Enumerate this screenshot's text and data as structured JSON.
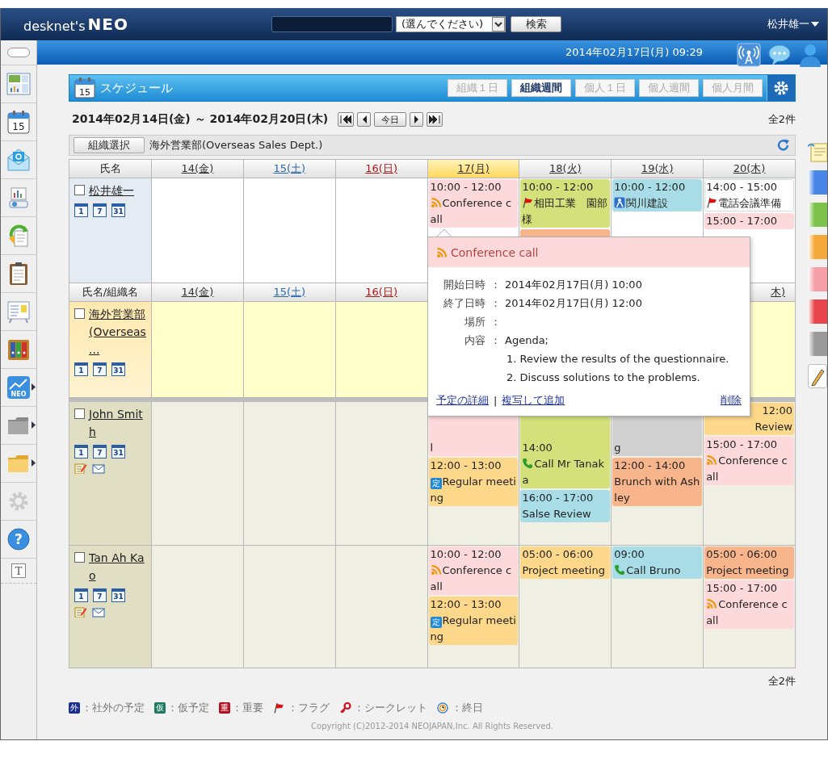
{
  "top_bar": {
    "logo": [
      "desknet's",
      "NEO"
    ],
    "search_select": "(選んでください)",
    "search_button": "検索",
    "user": "松井雄一"
  },
  "band": {
    "datetime": "2014年02月17日(月) 09:29",
    "tools": [
      {
        "kind": "antenna"
      },
      {
        "kind": "chat"
      },
      {
        "kind": "user"
      }
    ]
  },
  "sidebar": {
    "items": [
      {
        "kind": "toggle"
      },
      {
        "kind": "portal"
      },
      {
        "kind": "schedule",
        "label": "15"
      },
      {
        "kind": "mail"
      },
      {
        "kind": "projector"
      },
      {
        "kind": "workflow"
      },
      {
        "kind": "clipboard"
      },
      {
        "kind": "board"
      },
      {
        "kind": "binders"
      },
      {
        "kind": "chart",
        "label": "NEO",
        "submenu": true
      },
      {
        "kind": "folder_grey",
        "submenu": true
      },
      {
        "kind": "folder_yellow",
        "submenu": true
      },
      {
        "kind": "settings",
        "disabled": true
      },
      {
        "kind": "help",
        "label": "?"
      },
      {
        "kind": "text",
        "label": "T"
      }
    ]
  },
  "schedule": {
    "app_day": "15",
    "title": "スケジュール",
    "tabs": [
      {
        "label": "組織１日",
        "selected": false
      },
      {
        "label": "組織週間",
        "selected": true
      },
      {
        "label": "個人１日",
        "selected": false
      },
      {
        "label": "個人週間",
        "selected": false
      },
      {
        "label": "個人月間",
        "selected": false
      }
    ],
    "range": "2014年02月14日(金) ～ 2014年02月20日(木)",
    "nav": [
      {
        "kind": "first"
      },
      {
        "kind": "prev"
      },
      {
        "kind": "today",
        "label": "今日"
      },
      {
        "kind": "next"
      },
      {
        "kind": "last"
      }
    ],
    "count_top": "全2件",
    "org_button": "組織選択",
    "org_name": "海外営業部(Overseas Sales Dept.)",
    "grid": {
      "rows": [
        {
          "kind": "header",
          "first": "氏名",
          "days": [
            {
              "label": "14(金)",
              "kind": "weekday",
              "today": false
            },
            {
              "label": "15(土)",
              "kind": "sat",
              "today": false
            },
            {
              "label": "16(日)",
              "kind": "sun",
              "today": false
            },
            {
              "label": "17(月)",
              "kind": "weekday",
              "today": true
            },
            {
              "label": "18(火)",
              "kind": "weekday",
              "today": false
            },
            {
              "label": "19(水)",
              "kind": "weekday",
              "today": false
            },
            {
              "label": "20(木)",
              "kind": "weekday",
              "today": false
            }
          ]
        },
        {
          "kind": "self",
          "name": "松井雄一",
          "checked": false,
          "views": [
            "1",
            "7",
            "31"
          ],
          "cells": [
            [],
            [],
            [],
            [
              {
                "kind": "conference",
                "color": "#fdd9dc",
                "time": "10:00 - 12:00",
                "title": "Conference call"
              }
            ],
            [
              {
                "kind": "flagged",
                "color": "#d4e07a",
                "time": "10:00 - 12:00",
                "title": "相田工業　園部様"
              },
              {
                "kind": "plain",
                "color": "#f8b58c"
              }
            ],
            [
              {
                "kind": "visit",
                "color": "#a8dde8",
                "time": "10:00 - 12:00",
                "title": "関川建設"
              }
            ],
            [
              {
                "kind": "flagged",
                "color": "#ffffff",
                "time": "14:00 - 15:00",
                "title": "電話会議準備"
              },
              {
                "kind": "plain",
                "color": "#fdd9dc",
                "time": "15:00 - 17:00"
              }
            ]
          ]
        },
        {
          "kind": "header",
          "first": "氏名/組織名",
          "days": [
            {
              "label": "14(金)",
              "kind": "weekday",
              "today": false
            },
            {
              "label": "15(土)",
              "kind": "sat",
              "today": false
            },
            {
              "label": "16(日)",
              "kind": "sun",
              "today": false
            },
            {
              "label": "木)",
              "kind": "weekday",
              "today": false,
              "cut_left": true
            }
          ]
        },
        {
          "kind": "group",
          "name": "海外営業部(Overseas ...",
          "checked": false,
          "views": [
            "1",
            "7",
            "31"
          ],
          "cells": [
            [],
            [],
            [],
            [],
            [],
            [],
            []
          ]
        },
        {
          "kind": "member",
          "name": "John Smith",
          "checked": false,
          "views": [
            "1",
            "7",
            "31"
          ],
          "actions": [
            {
              "kind": "memo"
            },
            {
              "kind": "mail"
            }
          ],
          "cells": [
            [],
            [],
            [],
            [
              {
                "kind": "plain",
                "color": "#fdd9dc",
                "title": "l",
                "cut_top": true
              },
              {
                "kind": "plain",
                "color": "#fdd88a",
                "time": "12:00 - 13:00",
                "badge": "定",
                "title": "Regular meeting"
              }
            ],
            [
              {
                "kind": "call",
                "color": "#d4e07a",
                "time": "14:00",
                "title": "Call Mr Tanaka",
                "cut_top": true
              },
              {
                "kind": "plain",
                "color": "#a8dde8",
                "time": "16:00 - 17:00",
                "title": "Salse Review"
              }
            ],
            [
              {
                "kind": "plain",
                "color": "#d0d0d0",
                "title": "g",
                "cut_top": true
              },
              {
                "kind": "plain",
                "color": "#f8b58c",
                "time": "12:00 - 14:00",
                "title": "Brunch with Ashley"
              }
            ],
            [
              {
                "kind": "plain",
                "color": "#fdd88a",
                "time": "12:00",
                "title": "Review",
                "cut_left": true
              },
              {
                "kind": "conference",
                "color": "#fdd9dc",
                "time": "15:00 - 17:00",
                "title": "Conference call"
              }
            ]
          ]
        },
        {
          "kind": "member",
          "name": "Tan Ah Kao",
          "checked": false,
          "views": [
            "1",
            "7",
            "31"
          ],
          "actions": [
            {
              "kind": "memo"
            },
            {
              "kind": "mail"
            }
          ],
          "cells": [
            [],
            [],
            [],
            [
              {
                "kind": "conference",
                "color": "#fdd9dc",
                "time": "10:00 - 12:00",
                "title": "Conference call"
              },
              {
                "kind": "plain",
                "color": "#fdd88a",
                "time": "12:00 - 13:00",
                "badge": "定",
                "title": "Regular meeting"
              }
            ],
            [
              {
                "kind": "plain",
                "color": "#fdd88a",
                "time": "05:00 - 06:00",
                "title": "Project meeting"
              }
            ],
            [
              {
                "kind": "call",
                "color": "#a8dde8",
                "time": "09:00",
                "title": "Call Bruno"
              }
            ],
            [
              {
                "kind": "plain",
                "color": "#f8b58c",
                "time": "05:00 - 06:00",
                "title": "Project meeting"
              },
              {
                "kind": "conference",
                "color": "#fdd9dc",
                "time": "15:00 - 17:00",
                "title": "Conference call"
              }
            ]
          ]
        }
      ]
    },
    "popup": {
      "kind": "conference",
      "title": "Conference call",
      "fields": [
        {
          "label": "開始日時",
          "sep": "：",
          "lines": [
            "2014年02月17日(月) 10:00"
          ]
        },
        {
          "label": "終了日時",
          "sep": "：",
          "lines": [
            "2014年02月17日(月) 12:00"
          ]
        },
        {
          "label": "場所",
          "sep": "："
        },
        {
          "label": "内容",
          "sep": "：",
          "lines": [
            "Agenda;",
            "1. Review the results of the questionnaire.",
            "2. Discuss solutions to the problems."
          ]
        }
      ],
      "links": [
        "予定の詳細",
        "複写して追加"
      ],
      "link_divider": "|",
      "delete": "削除"
    },
    "count_bottom": "全2件",
    "legend": [
      {
        "kind": "tag",
        "mark": "外",
        "color": "#1c2f8c",
        "label": "：社外の予定"
      },
      {
        "kind": "tag",
        "mark": "仮",
        "color": "#1b7a60",
        "label": "：仮予定"
      },
      {
        "kind": "tag",
        "mark": "重",
        "color": "#b01020",
        "label": "：重要"
      },
      {
        "kind": "flag",
        "label": "：フラグ"
      },
      {
        "kind": "key",
        "label": "：シークレット"
      },
      {
        "kind": "allday",
        "label": "：終日"
      }
    ]
  },
  "sticky_tabs": [
    {
      "kind": "note"
    },
    {
      "kind": "tab",
      "color": "#4a86e8"
    },
    {
      "kind": "tab",
      "color": "#7cc24a"
    },
    {
      "kind": "tab",
      "color": "#f6a93b"
    },
    {
      "kind": "tab",
      "color": "#f7a0a8"
    },
    {
      "kind": "tab",
      "color": "#e8464c"
    },
    {
      "kind": "tab",
      "color": "#9a9a9a"
    },
    {
      "kind": "pencil"
    }
  ],
  "copyright": "Copyright (C)2012-2014 NEOJAPAN,Inc. All Rights Reserved."
}
